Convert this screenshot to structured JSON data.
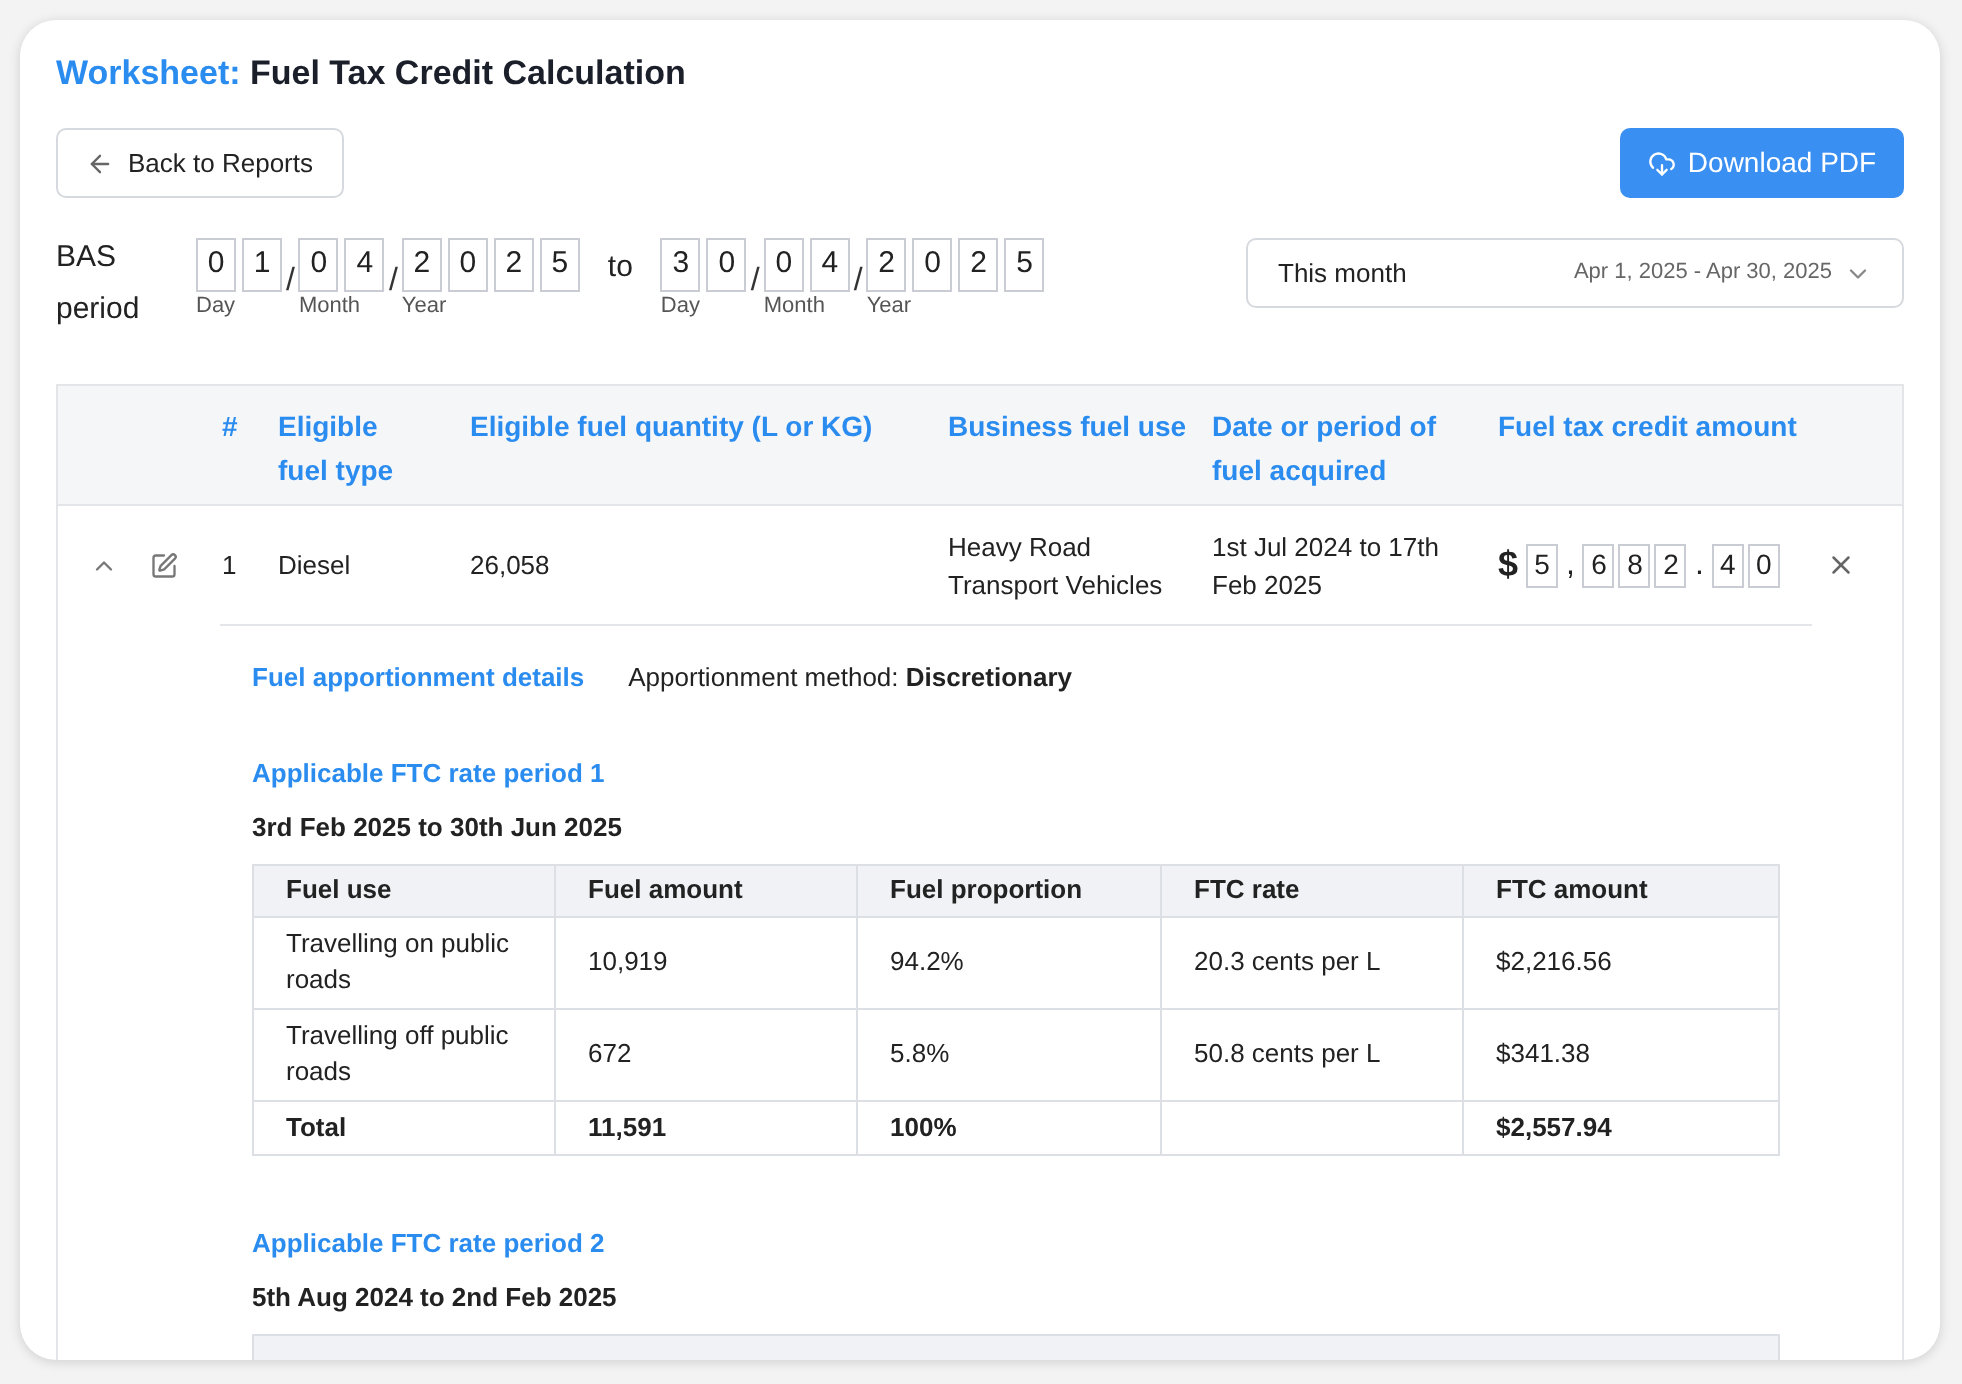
{
  "title": {
    "prefix": "Worksheet:",
    "text": "Fuel Tax Credit Calculation"
  },
  "back_button": {
    "label": "Back to Reports"
  },
  "download_button": {
    "label": "Download PDF"
  },
  "bas_period": {
    "label": "BAS period",
    "joiner": "to",
    "dates": [
      {
        "parts": [
          {
            "digits": [
              "0",
              "1"
            ],
            "caption": "Day"
          },
          {
            "digits": [
              "0",
              "4"
            ],
            "caption": "Month"
          },
          {
            "digits": [
              "2",
              "0",
              "2",
              "5"
            ],
            "caption": "Year"
          }
        ],
        "separators": [
          "/",
          "/"
        ]
      },
      {
        "parts": [
          {
            "digits": [
              "3",
              "0"
            ],
            "caption": "Day"
          },
          {
            "digits": [
              "0",
              "4"
            ],
            "caption": "Month"
          },
          {
            "digits": [
              "2",
              "0",
              "2",
              "5"
            ],
            "caption": "Year"
          }
        ],
        "separators": [
          "/",
          "/"
        ]
      }
    ],
    "preset": {
      "value": "This month",
      "range": "Apr 1, 2025 - Apr 30, 2025"
    }
  },
  "table": {
    "columns": [
      "#",
      "Eligible fuel type",
      "Eligible fuel quantity (L or KG)",
      "Business fuel use",
      "Date or period of fuel acquired",
      "Fuel tax credit amount"
    ],
    "rows": [
      {
        "expanded": true,
        "number": "1",
        "fuel_type": "Diesel",
        "quantity": "26,058",
        "use": "Heavy Road Transport Vehicles",
        "date": "1st Jul 2024 to 17th Feb 2025",
        "currency": "$",
        "amount": [
          {
            "kind": "digit",
            "char": "5"
          },
          {
            "kind": "sep",
            "char": ","
          },
          {
            "kind": "digit",
            "char": "6"
          },
          {
            "kind": "digit",
            "char": "8"
          },
          {
            "kind": "digit",
            "char": "2"
          },
          {
            "kind": "sep",
            "char": "."
          },
          {
            "kind": "digit",
            "char": "4"
          },
          {
            "kind": "digit",
            "char": "0"
          }
        ],
        "details": {
          "title": "Fuel apportionment details",
          "method_label": "Apportionment method:",
          "method": "Discretionary",
          "periods": [
            {
              "title": "Applicable FTC rate period 1",
              "range": "3rd Feb 2025 to 30th Jun 2025",
              "columns": [
                "Fuel use",
                "Fuel amount",
                "Fuel proportion",
                "FTC rate",
                "FTC amount"
              ],
              "rows": [
                [
                  "Travelling on public roads",
                  "10,919",
                  "94.2%",
                  "20.3 cents per L",
                  "$2,216.56"
                ],
                [
                  "Travelling off public roads",
                  "672",
                  "5.8%",
                  "50.8 cents per L",
                  "$341.38"
                ]
              ],
              "total": {
                "label": "Total",
                "fuel_amount": "11,591",
                "proportion": "100%",
                "ftc_amount": "$2,557.94"
              }
            },
            {
              "title": "Applicable FTC rate period 2",
              "range": "5th Aug 2024 to 2nd Feb 2025",
              "table_cut_off": true
            }
          ]
        }
      }
    ]
  }
}
